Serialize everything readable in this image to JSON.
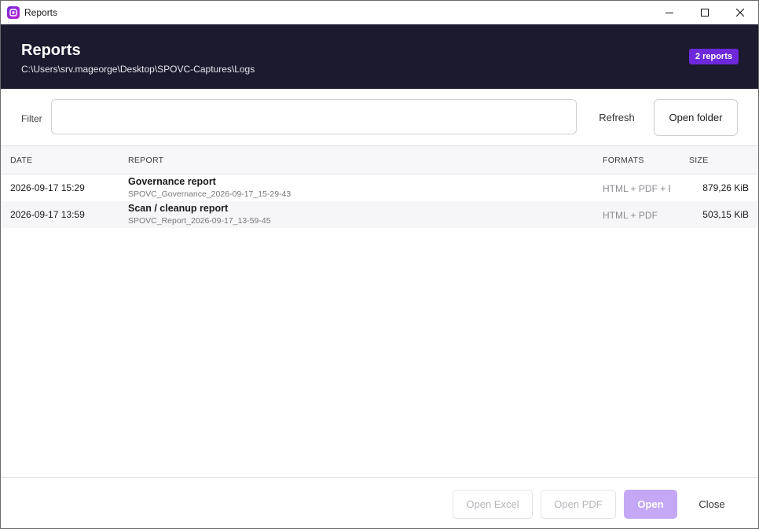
{
  "window": {
    "title": "Reports",
    "icon": "app-logo-icon",
    "controls": {
      "minimize": "minimize-icon",
      "maximize": "maximize-icon",
      "close": "close-icon"
    }
  },
  "header": {
    "title": "Reports",
    "path": "C:\\Users\\srv.mageorge\\Desktop\\SPOVC-Captures\\Logs",
    "badge": "2 reports"
  },
  "toolbar": {
    "filter_label": "Filter",
    "filter_value": "",
    "refresh_label": "Refresh",
    "open_folder_label": "Open folder"
  },
  "table": {
    "columns": [
      "DATE",
      "REPORT",
      "FORMATS",
      "SIZE"
    ],
    "rows": [
      {
        "date": "2026-09-17 15:29",
        "name": "Governance report",
        "file": "SPOVC_Governance_2026-09-17_15-29-43",
        "formats": "HTML + PDF + Excel",
        "size": "879,26 KiB"
      },
      {
        "date": "2026-09-17 13:59",
        "name": "Scan / cleanup report",
        "file": "SPOVC_Report_2026-09-17_13-59-45",
        "formats": "HTML + PDF",
        "size": "503,15 KiB"
      }
    ]
  },
  "footer": {
    "open_excel": "Open Excel",
    "open_pdf": "Open PDF",
    "open": "Open",
    "close": "Close"
  },
  "colors": {
    "header_bg": "#1c1a2e",
    "accent": "#6d28d9",
    "open_button_disabled": "#c4a8f5"
  }
}
